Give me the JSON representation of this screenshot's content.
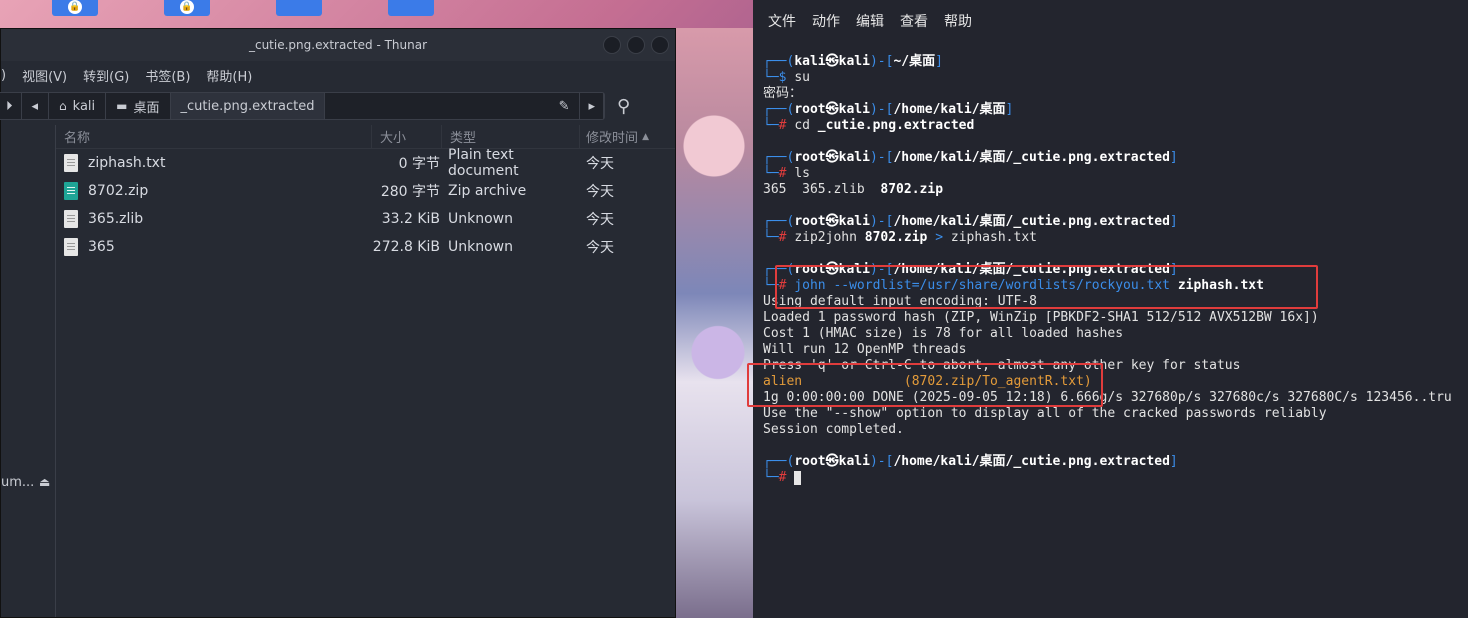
{
  "thunar": {
    "title": "_cutie.png.extracted - Thunar",
    "menu": [
      ")",
      "视图(V)",
      "转到(G)",
      "书签(B)",
      "帮助(H)"
    ],
    "breadcrumbs": [
      "kali",
      "桌面",
      "_cutie.png.extracted"
    ],
    "sidebar_partial_label": "um...",
    "columns": {
      "name": "名称",
      "size": "大小",
      "type": "类型",
      "date": "修改时间"
    },
    "files": [
      {
        "name": "ziphash.txt",
        "size": "0 字节",
        "type": "Plain text document",
        "date": "今天",
        "icon": "text-file-icon"
      },
      {
        "name": "8702.zip",
        "size": "280 字节",
        "type": "Zip archive",
        "date": "今天",
        "icon": "zip-file-icon"
      },
      {
        "name": "365.zlib",
        "size": "33.2 KiB",
        "type": "Unknown",
        "date": "今天",
        "icon": "unknown-file-icon"
      },
      {
        "name": "365",
        "size": "272.8 KiB",
        "type": "Unknown",
        "date": "今天",
        "icon": "unknown-file-icon"
      }
    ]
  },
  "terminal": {
    "menu": [
      "文件",
      "动作",
      "编辑",
      "查看",
      "帮助"
    ],
    "user1": "kali",
    "host": "kali",
    "path_home": "~/桌面",
    "cmd_su": "su",
    "password_prompt": "密码：",
    "root_user": "root",
    "path_desktop": "/home/kali/桌面",
    "cmd_cd": "cd",
    "cmd_cd_arg": "_cutie.png.extracted",
    "path_extracted": "/home/kali/桌面/_cutie.png.extracted",
    "cmd_ls": "ls",
    "ls_output_plain": "365  365.zlib  ",
    "ls_output_zip": "8702.zip",
    "cmd_zip2john": "zip2john",
    "zip2john_arg": "8702.zip",
    "redirect": ">",
    "zip2john_out": "ziphash.txt",
    "cmd_john": "john --wordlist=/usr/share/wordlists/rockyou.txt",
    "john_arg": "ziphash.txt",
    "output": [
      "Using default input encoding: UTF-8",
      "Loaded 1 password hash (ZIP, WinZip [PBKDF2-SHA1 512/512 AVX512BW 16x])",
      "Cost 1 (HMAC size) is 78 for all loaded hashes",
      "Will run 12 OpenMP threads",
      "Press 'q' or Ctrl-C to abort, almost any other key for status"
    ],
    "cracked_password": "alien",
    "cracked_file": "(8702.zip/To_agentR.txt)",
    "done_line": "1g 0:00:00:00 DONE (2025-09-05 12:18) 6.666g/s 327680p/s 327680c/s 327680C/s 123456..tru",
    "show_hint": "Use the \"--show\" option to display all of the cracked passwords reliably",
    "session_done": "Session completed."
  }
}
